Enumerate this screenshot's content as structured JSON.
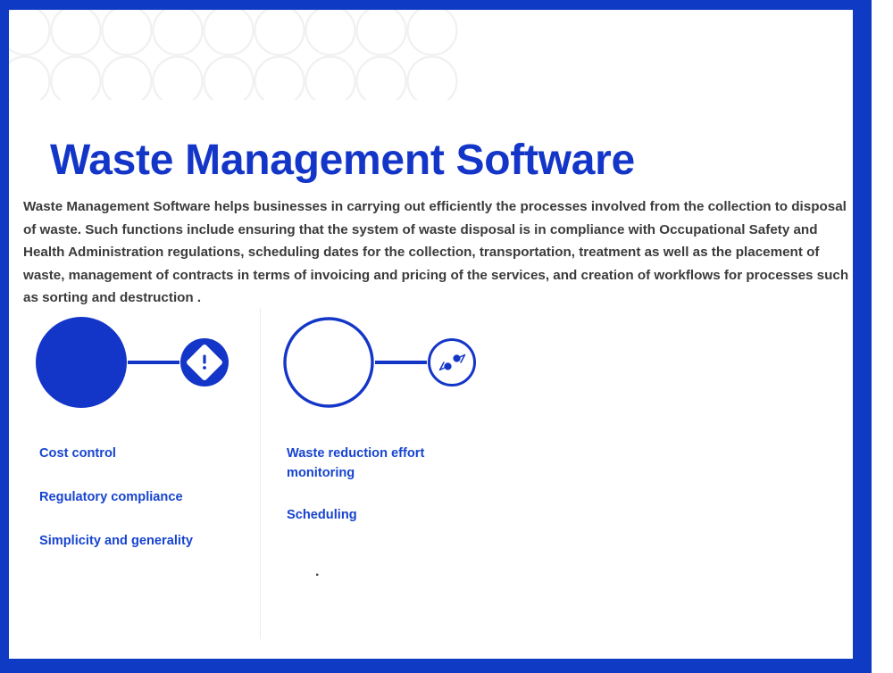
{
  "theme": {
    "frame_blue": "#0f3bc4",
    "title_blue": "#1436c8",
    "label_blue": "#1744cf",
    "body_gray": "#3b3b3b",
    "pattern_gray": "#f1f1f2",
    "divider_gray": "#ececed",
    "background": "#ffffff"
  },
  "slide": {
    "title": "Waste Management Software",
    "body": "Waste Management Software helps businesses in carrying out efficiently the processes involved from the collection to disposal of waste. Such functions include ensuring that the system of waste disposal is in compliance with Occupational Safety and Health Administration regulations, scheduling dates for the collection, transportation, treatment as well as the placement of waste, management of contracts in terms of invoicing and pricing of the services, and creation of workflows for processes such as sorting and destruction ."
  },
  "columns": [
    {
      "graphic": {
        "large_circle_style": "filled",
        "small_circle_style": "filled",
        "icon": "warning-diamond-icon"
      },
      "labels": [
        "Cost control",
        "Regulatory compliance",
        "Simplicity and generality"
      ]
    },
    {
      "graphic": {
        "large_circle_style": "outline",
        "small_circle_style": "outline",
        "icon": "diagonal-resize-icon"
      },
      "labels": [
        "Waste reduction effort monitoring",
        "Scheduling"
      ],
      "trailing_text": "."
    }
  ]
}
